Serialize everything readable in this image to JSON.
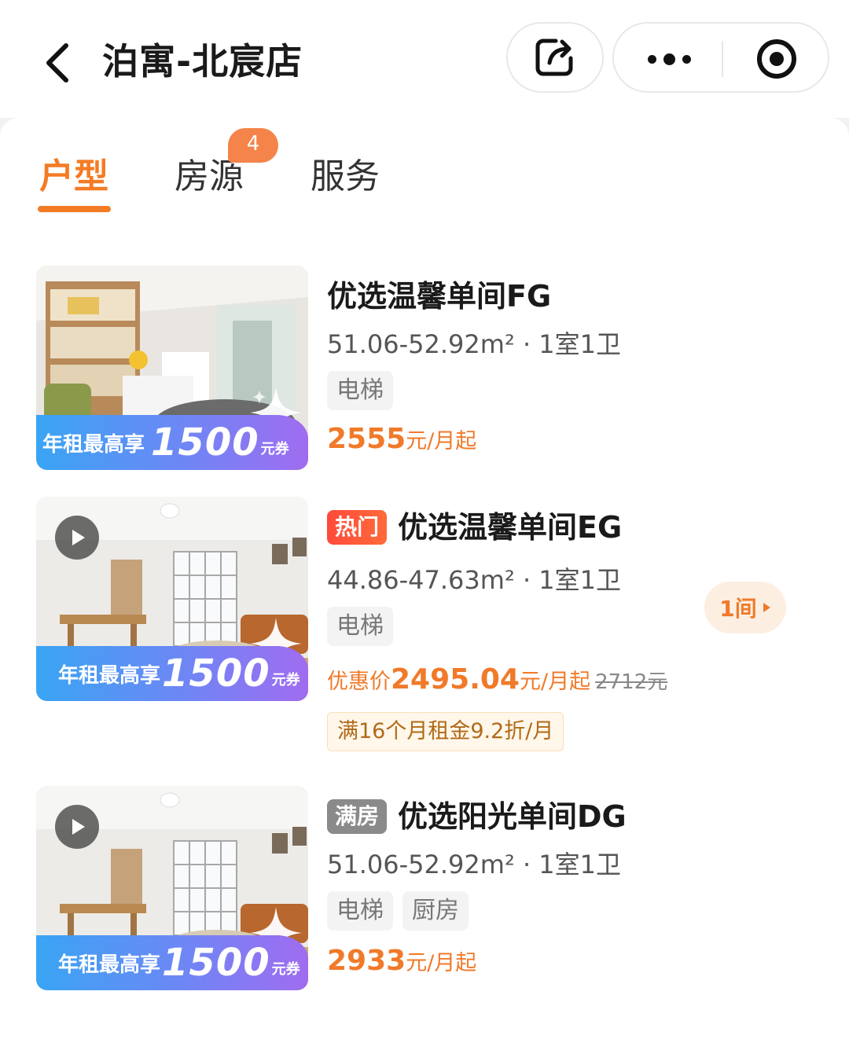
{
  "header": {
    "title": "泊寓-北宸店"
  },
  "tabs": [
    {
      "label": "户型",
      "active": true
    },
    {
      "label": "房源",
      "badge": "4"
    },
    {
      "label": "服务"
    }
  ],
  "units": [
    {
      "name": "优选温馨单间FG",
      "flag": "",
      "spec": "51.06-52.92m² · 1室1卫",
      "tags": [
        "电梯"
      ],
      "price_value": "2555",
      "price_unit": "元/月起",
      "promo": {
        "text": "年租最高享",
        "amount": "1500",
        "unit": "元券"
      },
      "video": false
    },
    {
      "name": "优选温馨单间EG",
      "flag": "热门",
      "spec": "44.86-47.63m² · 1室1卫",
      "tags": [
        "电梯"
      ],
      "price_prefix": "优惠价",
      "price_value": "2495.04",
      "price_unit": "元/月起",
      "price_original": "2712元",
      "discount": "满16个月租金9.2折/月",
      "rooms_available": "1间",
      "promo": {
        "text": "年租最高享",
        "amount": "1500",
        "unit": "元券"
      },
      "video": true
    },
    {
      "name": "优选阳光单间DG",
      "flag": "满房",
      "spec": "51.06-52.92m² · 1室1卫",
      "tags": [
        "电梯",
        "厨房"
      ],
      "price_value": "2933",
      "price_unit": "元/月起",
      "promo": {
        "text": "年租最高享",
        "amount": "1500",
        "unit": "元券"
      },
      "video": true
    }
  ],
  "colors": {
    "accent": "#f47b25",
    "price": "#f07a2a",
    "hot_flag": "#ff4a3a",
    "full_flag": "#8a8a8a",
    "promo_gradient": [
      "#39a5f4",
      "#a06cf0"
    ]
  },
  "icons": [
    "back-arrow-icon",
    "share-icon",
    "more-dots-icon",
    "target-icon",
    "play-icon",
    "sparkle-icon",
    "chevron-right-icon"
  ]
}
